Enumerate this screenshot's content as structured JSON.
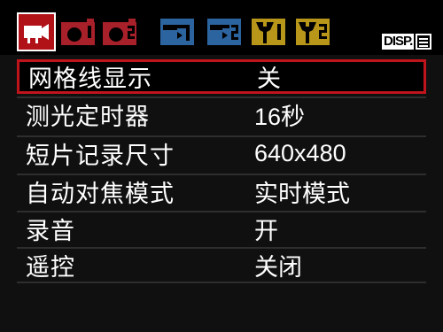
{
  "tabs": [
    {
      "icon": "movie-camera-icon",
      "color": "#ffffff",
      "active": true
    },
    {
      "icon": "camera-1-icon",
      "color": "#a8202a",
      "active": false
    },
    {
      "icon": "camera-2-icon",
      "color": "#a8202a",
      "active": false
    },
    {
      "icon": "playback-1-icon",
      "color": "#2c64a0",
      "active": false
    },
    {
      "icon": "playback-2-icon",
      "color": "#2c64a0",
      "active": false
    },
    {
      "icon": "setup-1-icon",
      "color": "#b8961a",
      "active": false
    },
    {
      "icon": "setup-2-icon",
      "color": "#b8961a",
      "active": false
    }
  ],
  "disp_button": {
    "label": "DISP."
  },
  "colors": {
    "accent": "#c0141c",
    "panel": "#101010"
  },
  "menu": [
    {
      "label": "网格线显示",
      "value": "关",
      "selected": true
    },
    {
      "label": "测光定时器",
      "value": "16秒",
      "selected": false
    },
    {
      "label": "短片记录尺寸",
      "value": "640x480",
      "selected": false
    },
    {
      "label": "自动对焦模式",
      "value": "实时模式",
      "selected": false
    },
    {
      "label": "录音",
      "value": "开",
      "selected": false
    },
    {
      "label": "遥控",
      "value": "关闭",
      "selected": false
    }
  ]
}
